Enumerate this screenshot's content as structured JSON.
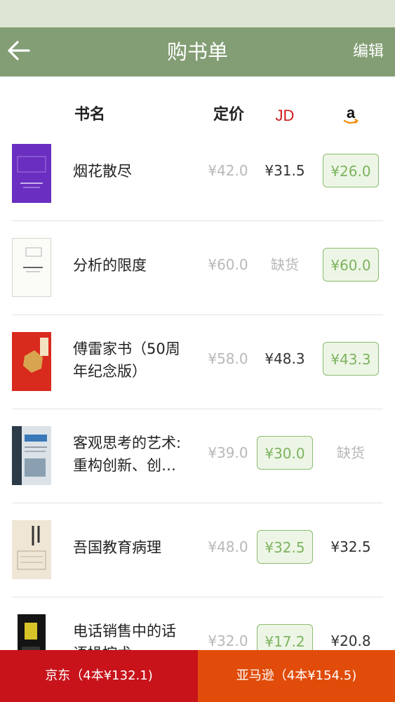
{
  "header": {
    "title": "购书单",
    "edit_label": "编辑"
  },
  "columns": {
    "name": "书名",
    "list_price": "定价",
    "jd_logo_text": "JD",
    "amazon_logo_text": "a"
  },
  "colors": {
    "appbar": "#839e74",
    "jd_red": "#c8131b",
    "amazon_orange": "#e14c0a",
    "best_green": "#7db35f"
  },
  "books": [
    {
      "title_lines": [
        "烟花散尽"
      ],
      "list_price": "¥42.0",
      "jd": "¥31.5",
      "amazon": "¥26.0",
      "best": "amazon"
    },
    {
      "title_lines": [
        "分析的限度"
      ],
      "list_price": "¥60.0",
      "jd": "缺货",
      "amazon": "¥60.0",
      "best": "amazon"
    },
    {
      "title_lines": [
        "傅雷家书（50周",
        "年纪念版）"
      ],
      "list_price": "¥58.0",
      "jd": "¥48.3",
      "amazon": "¥43.3",
      "best": "amazon"
    },
    {
      "title_lines": [
        "客观思考的艺术:",
        "重构创新、创…"
      ],
      "list_price": "¥39.0",
      "jd": "¥30.0",
      "amazon": "缺货",
      "best": "jd"
    },
    {
      "title_lines": [
        "吾国教育病理"
      ],
      "list_price": "¥48.0",
      "jd": "¥32.5",
      "amazon": "¥32.5",
      "best": "jd"
    },
    {
      "title_lines": [
        "电话销售中的话",
        "语操控术"
      ],
      "list_price": "¥32.0",
      "jd": "¥17.2",
      "amazon": "¥20.8",
      "best": "jd"
    }
  ],
  "footer": {
    "jd_button": "京东（4本¥132.1)",
    "amazon_button": "亚马逊（4本¥154.5)"
  }
}
